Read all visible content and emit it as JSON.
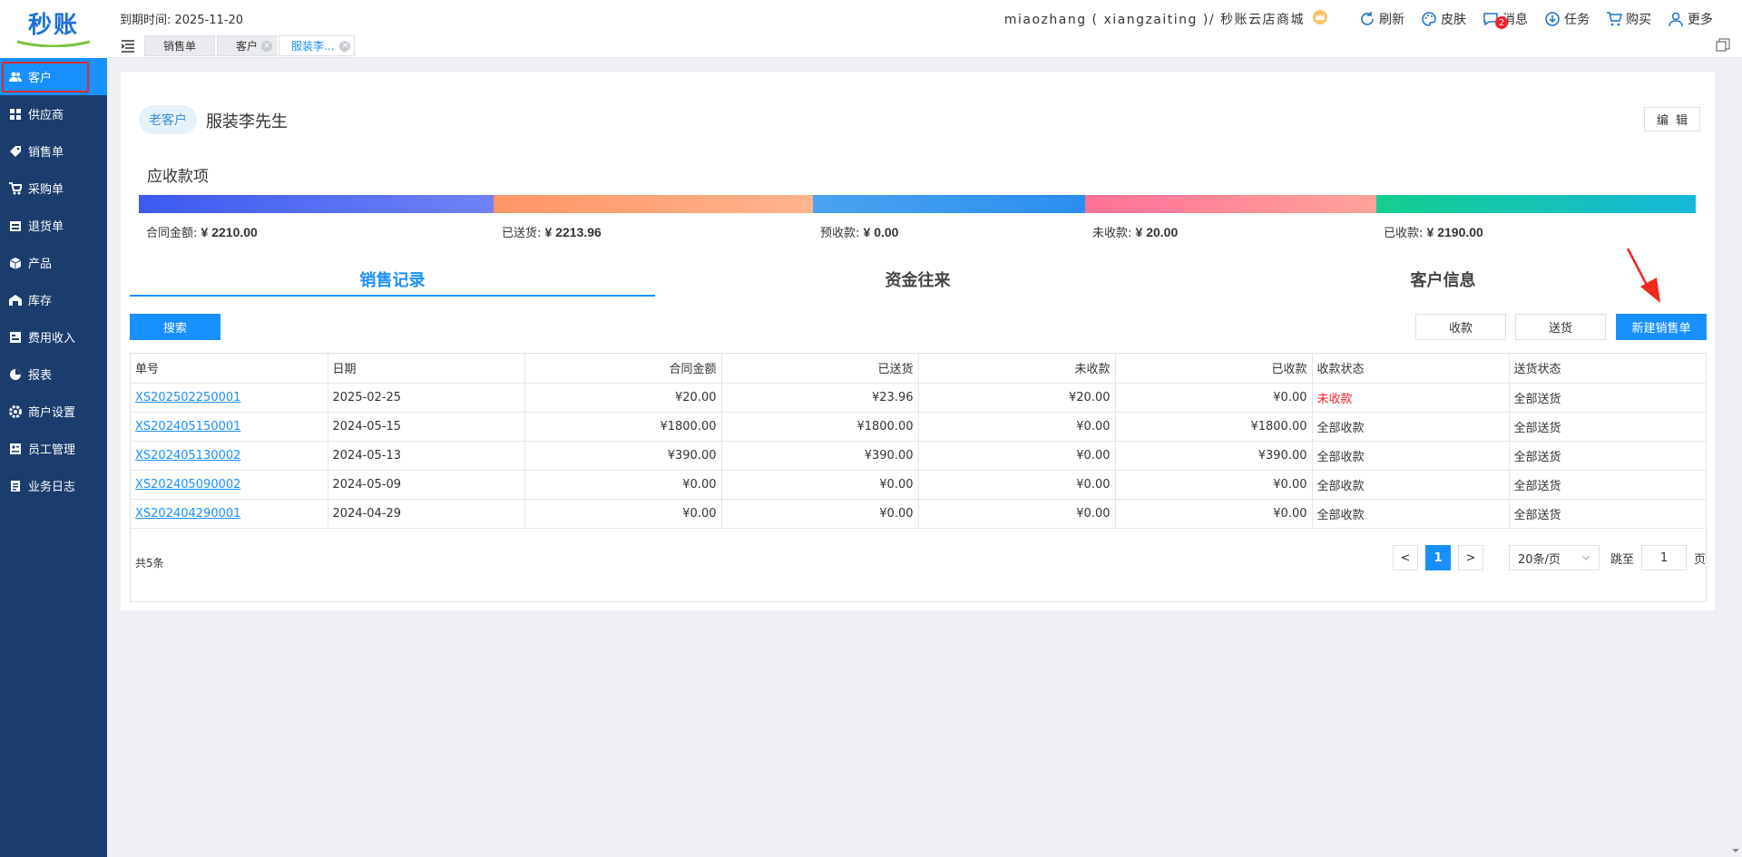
{
  "sidebar": {
    "logo": "秒账",
    "items": [
      {
        "label": "客户",
        "icon": "users-icon",
        "active": true
      },
      {
        "label": "供应商",
        "icon": "supplier-icon"
      },
      {
        "label": "销售单",
        "icon": "tag-icon"
      },
      {
        "label": "采购单",
        "icon": "cart-icon"
      },
      {
        "label": "退货单",
        "icon": "return-icon"
      },
      {
        "label": "产品",
        "icon": "box-icon"
      },
      {
        "label": "库存",
        "icon": "warehouse-icon"
      },
      {
        "label": "费用收入",
        "icon": "expense-icon"
      },
      {
        "label": "报表",
        "icon": "pie-chart-icon"
      },
      {
        "label": "商户设置",
        "icon": "gear-icon"
      },
      {
        "label": "员工管理",
        "icon": "staff-icon"
      },
      {
        "label": "业务日志",
        "icon": "log-icon"
      }
    ]
  },
  "topbar": {
    "expire_text": "到期时间: 2025-11-20",
    "store": "miaozhang ( xiangzaiting )/ 秒账云店商城",
    "refresh": "刷新",
    "skin": "皮肤",
    "message": "消息",
    "message_count": "2",
    "task": "任务",
    "buy": "购买",
    "more": "更多"
  },
  "tabs": [
    {
      "label": "销售单"
    },
    {
      "label": "客户"
    },
    {
      "label": "服装李...",
      "active": true
    }
  ],
  "customer": {
    "badge": "老客户",
    "name": "服装李先生",
    "edit": "编辑"
  },
  "receivables": {
    "title": "应收款项",
    "items": [
      {
        "label": "合同金额:",
        "value": "¥ 2210.00",
        "color_from": "#3d5af1",
        "color_to": "#6f83f7"
      },
      {
        "label": "已送货:",
        "value": "¥ 2213.96",
        "color_from": "#ff9566",
        "color_to": "#ffb48f"
      },
      {
        "label": "预收款:",
        "value": "¥ 0.00",
        "color_from": "#4aa3f0",
        "color_to": "#2b8ef0"
      },
      {
        "label": "未收款:",
        "value": "¥ 20.00",
        "color_from": "#ff7197",
        "color_to": "#ffa39a"
      },
      {
        "label": "已收款:",
        "value": "¥ 2190.00",
        "color_from": "#14cf8f",
        "color_to": "#17b8da"
      }
    ]
  },
  "sub_tabs": [
    {
      "label": "销售记录",
      "active": true
    },
    {
      "label": "资金往来"
    },
    {
      "label": "客户信息"
    }
  ],
  "actions": {
    "search": "搜索",
    "collect": "收款",
    "deliver": "送货",
    "new_order": "新建销售单"
  },
  "table": {
    "headers": [
      "单号",
      "日期",
      "合同金额",
      "已送货",
      "未收款",
      "已收款",
      "收款状态",
      "送货状态"
    ],
    "rows": [
      [
        "XS202502250001",
        "2025-02-25",
        "¥20.00",
        "¥23.96",
        "¥20.00",
        "¥0.00",
        "未收款",
        "全部送货"
      ],
      [
        "XS202405150001",
        "2024-05-15",
        "¥1800.00",
        "¥1800.00",
        "¥0.00",
        "¥1800.00",
        "全部收款",
        "全部送货"
      ],
      [
        "XS202405130002",
        "2024-05-13",
        "¥390.00",
        "¥390.00",
        "¥0.00",
        "¥390.00",
        "全部收款",
        "全部送货"
      ],
      [
        "XS202405090002",
        "2024-05-09",
        "¥0.00",
        "¥0.00",
        "¥0.00",
        "¥0.00",
        "全部收款",
        "全部送货"
      ],
      [
        "XS202404290001",
        "2024-04-29",
        "¥0.00",
        "¥0.00",
        "¥0.00",
        "¥0.00",
        "全部收款",
        "全部送货"
      ]
    ]
  },
  "pagination": {
    "total": "共5条",
    "prev": "<",
    "current": "1",
    "next": ">",
    "page_size": "20条/页",
    "jump_label": "跳至",
    "jump_value": "1",
    "page_suffix": "页"
  },
  "colors": {
    "sidebar_bg": "#1b3d6e",
    "accent": "#1890ff",
    "highlight": "#e0282e",
    "unpaid": "#f5222d"
  }
}
